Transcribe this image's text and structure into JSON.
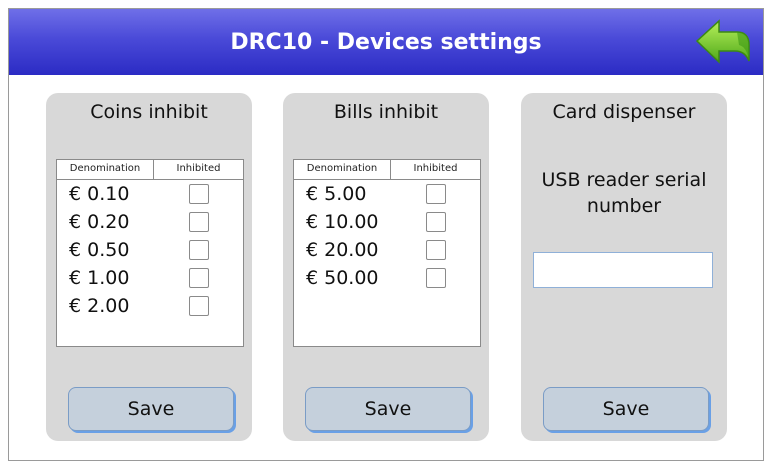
{
  "header": {
    "title": "DRC10 - Devices settings",
    "back_icon": "green-back-arrow-icon"
  },
  "coins": {
    "title": "Coins inhibit",
    "col_denomination": "Denomination",
    "col_inhibited": "Inhibited",
    "rows": [
      {
        "value": "€ 0.10",
        "inhibited": false
      },
      {
        "value": "€ 0.20",
        "inhibited": false
      },
      {
        "value": "€ 0.50",
        "inhibited": false
      },
      {
        "value": "€ 1.00",
        "inhibited": false
      },
      {
        "value": "€ 2.00",
        "inhibited": false
      }
    ],
    "save_label": "Save"
  },
  "bills": {
    "title": "Bills inhibit",
    "col_denomination": "Denomination",
    "col_inhibited": "Inhibited",
    "rows": [
      {
        "value": "€ 5.00",
        "inhibited": false
      },
      {
        "value": "€ 10.00",
        "inhibited": false
      },
      {
        "value": "€ 20.00",
        "inhibited": false
      },
      {
        "value": "€ 50.00",
        "inhibited": false
      }
    ],
    "save_label": "Save"
  },
  "card": {
    "title": "Card dispenser",
    "usb_label_line1": "USB reader serial",
    "usb_label_line2": "number",
    "usb_value": "",
    "save_label": "Save"
  },
  "colors": {
    "header_blue": "#3a3ad0",
    "panel_gray": "#d8d8d8",
    "button_fill": "#c5d0dc",
    "back_arrow_green": "#7ed321"
  }
}
